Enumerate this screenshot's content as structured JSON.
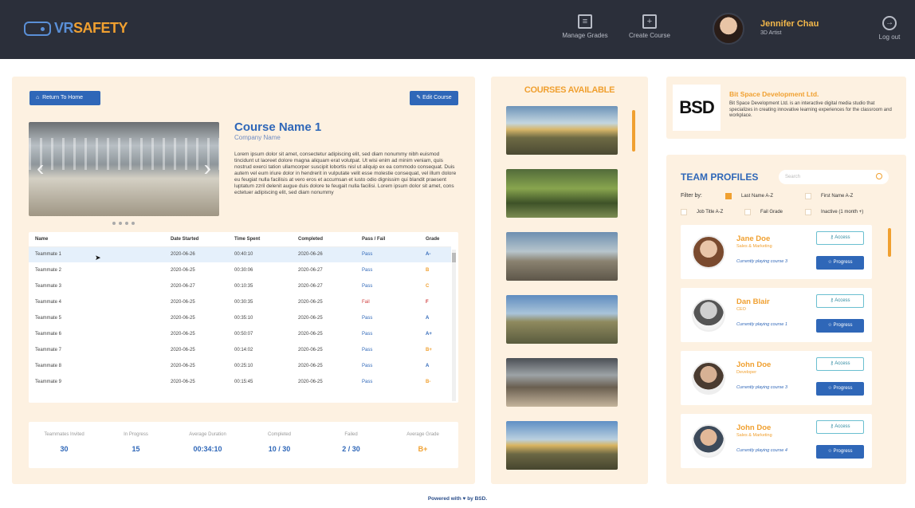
{
  "header": {
    "logo_vr": "VR",
    "logo_safety": "SAFETY",
    "manage_grades": "Manage Grades",
    "create_course": "Create Course",
    "user_name": "Jennifer Chau",
    "user_role": "3D Artist",
    "logout": "Log out"
  },
  "course": {
    "return_label": "Return To Home",
    "edit_label": "Edit Course",
    "title": "Course Name 1",
    "company": "Company Name",
    "description": "Lorem ipsum dolor sit amet, consectetur adipiscing elit, sed diam nonummy nibh euismod tincidunt ut laoreet dolore magna aliquam erat volutpat. Ut wisi enim ad minim veniam, quis nostrud exerci tation ullamcorper suscipit lobortis nisl ut aliquip ex ea commodo consequat. Duis autem vel eum iriure dolor in hendrerit in vulputate velit esse molestie consequat, vel illum dolore eu feugiat nulla facilisis at vero eros et accumsan et iusto odio dignissim qui blandit praesent luptatum zzril delenit augue duis dolore te feugait nulla facilisi. Lorem ipsum dolor sit amet, cons ectetuer adipiscing elit, sed diam nonummy"
  },
  "table": {
    "headers": [
      "Name",
      "Date Started",
      "Time Spent",
      "Completed",
      "Pass / Fail",
      "Grade"
    ],
    "rows": [
      [
        "Teammate 1",
        "2020-06-26",
        "00:40:10",
        "2020-06-26",
        "Pass",
        "A-"
      ],
      [
        "Teammate 2",
        "2020-06-25",
        "00:30:06",
        "2020-06-27",
        "Pass",
        "B"
      ],
      [
        "Teammate 3",
        "2020-06-27",
        "00:10:35",
        "2020-06-27",
        "Pass",
        "C"
      ],
      [
        "Teammate 4",
        "2020-06-25",
        "00:30:35",
        "2020-06-25",
        "Fail",
        "F"
      ],
      [
        "Teammate 5",
        "2020-06-25",
        "00:35:10",
        "2020-06-25",
        "Pass",
        "A"
      ],
      [
        "Teammate 6",
        "2020-06-25",
        "00:50:07",
        "2020-06-25",
        "Pass",
        "A+"
      ],
      [
        "Teammate 7",
        "2020-06-25",
        "00:14:02",
        "2020-06-25",
        "Pass",
        "B+"
      ],
      [
        "Teammate 8",
        "2020-06-25",
        "00:25:10",
        "2020-06-25",
        "Pass",
        "A"
      ],
      [
        "Teammate 9",
        "2020-06-25",
        "00:15:45",
        "2020-06-25",
        "Pass",
        "B-"
      ]
    ]
  },
  "stats": [
    {
      "label": "Teammates Invited",
      "value": "30"
    },
    {
      "label": "In Progress",
      "value": "15"
    },
    {
      "label": "Average Duration",
      "value": "00:34:10"
    },
    {
      "label": "Completed",
      "value": "10 / 30"
    },
    {
      "label": "Failed",
      "value": "2 / 30"
    },
    {
      "label": "Average Grade",
      "value": "B+"
    }
  ],
  "courses": {
    "title": "COURSES AVAILABLE"
  },
  "company_info": {
    "logo": "BSD",
    "name": "Bit Space Development Ltd.",
    "description": "Bit Space Development Ltd. is an interactive digital media studio that specializes in creating innovative learning experiences for the classroom and workplace."
  },
  "team": {
    "title": "TEAM PROFILES",
    "search_placeholder": "Search",
    "filter_label": "Filter by:",
    "filters": [
      "Last Name A-Z",
      "First Name A-Z",
      "Job Title A-Z",
      "Fail Grade",
      "Inactive (1 month +)"
    ],
    "access_label": "Access",
    "progress_label": "Progress",
    "members": [
      {
        "name": "Jane Doe",
        "role": "Sales & Marketing",
        "status": "Currently playing course 3"
      },
      {
        "name": "Dan Blair",
        "role": "CEO",
        "status": "Currently playing course 1"
      },
      {
        "name": "John Doe",
        "role": "Developer",
        "status": "Currently playing course 3"
      },
      {
        "name": "John Doe",
        "role": "Sales & Marketing",
        "status": "Currently playing course 4"
      }
    ]
  },
  "footer": "Powered with ♥ by BSD."
}
